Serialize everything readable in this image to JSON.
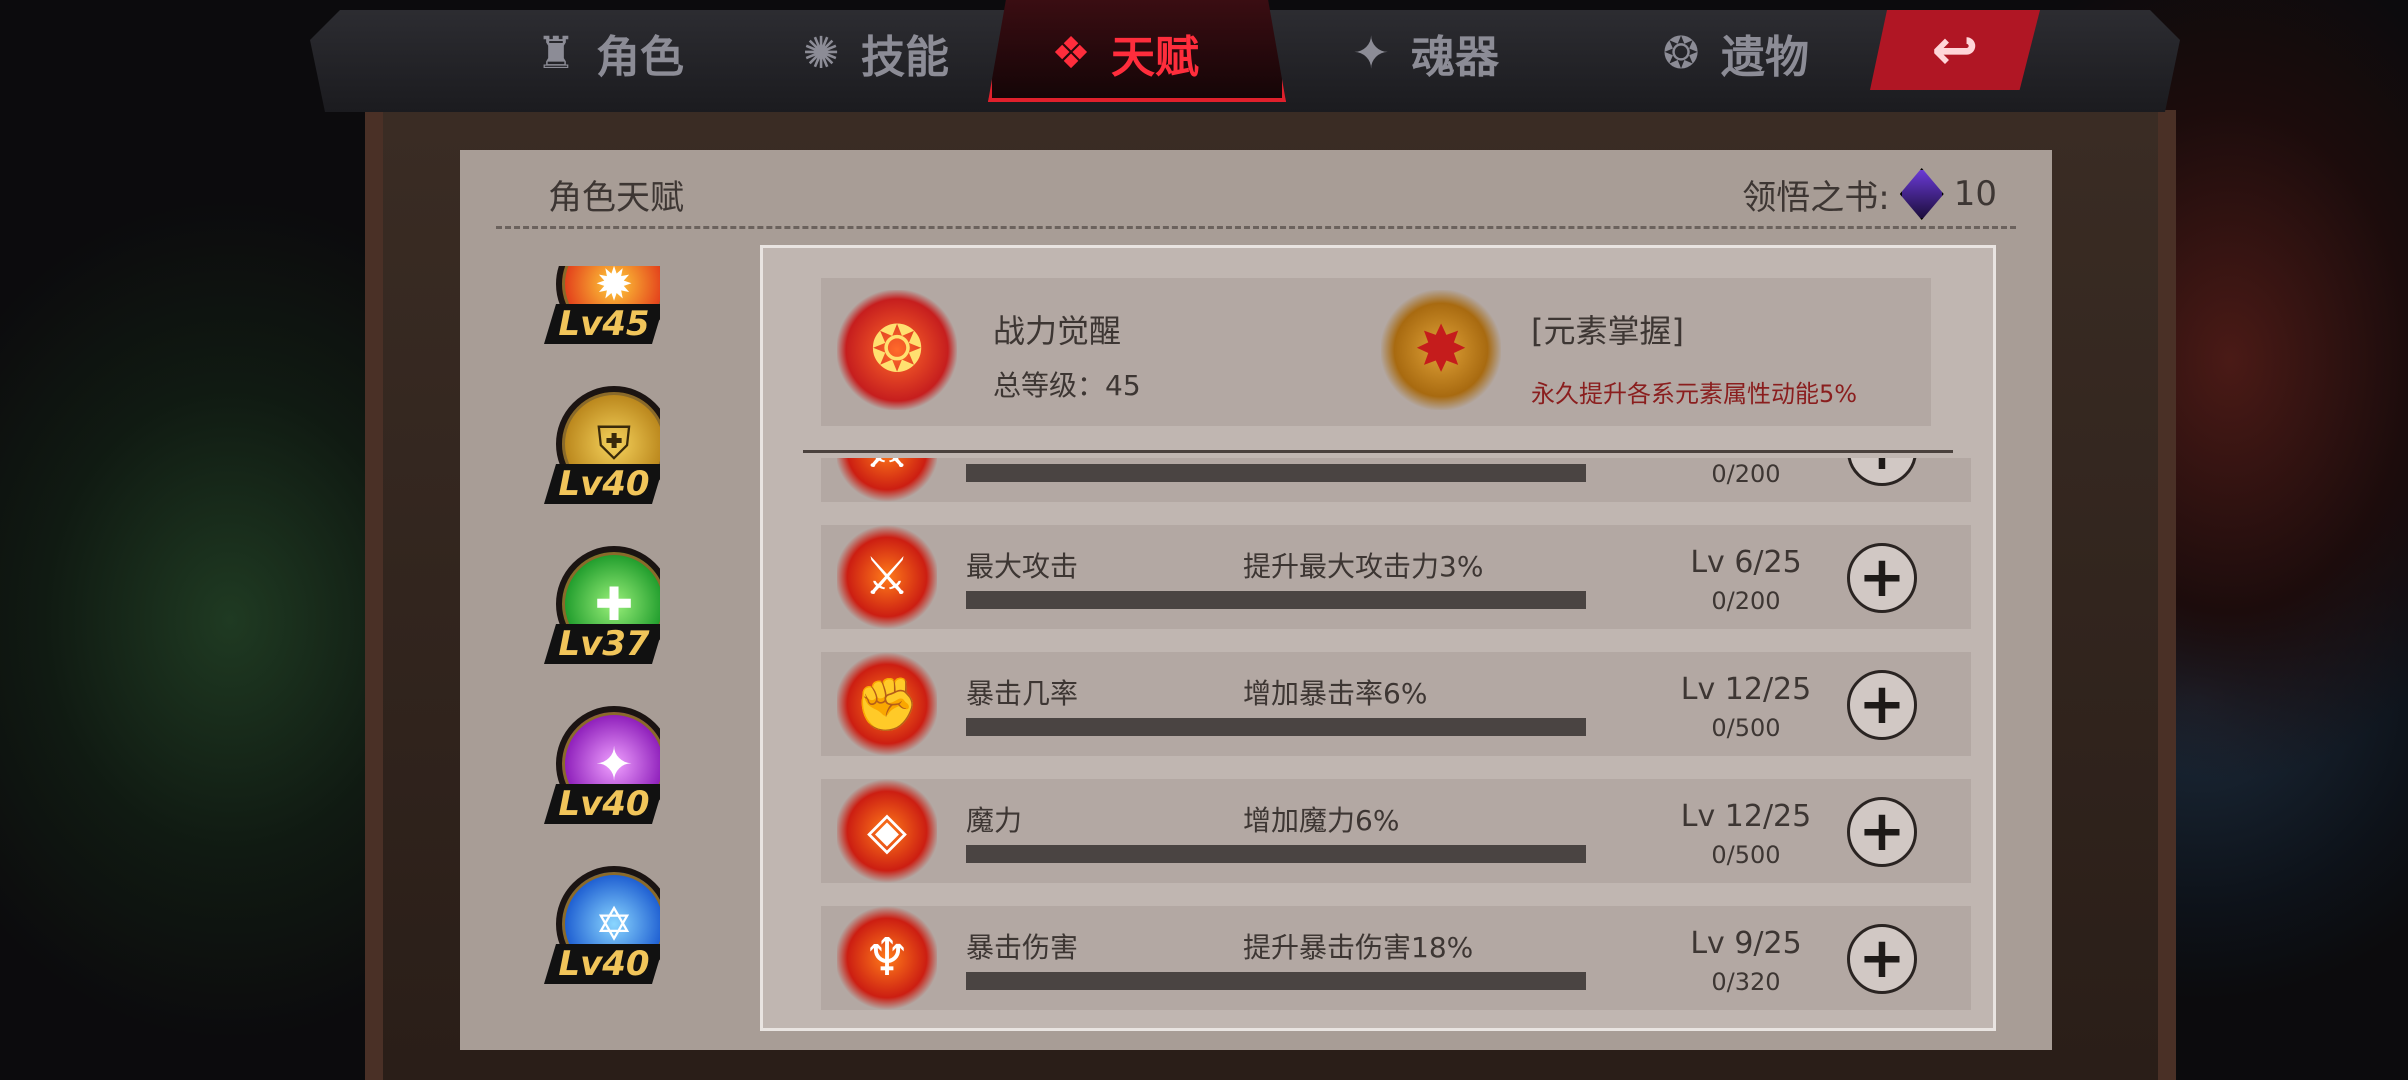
{
  "tabs": [
    {
      "label": "角色",
      "icon": "helmet-icon",
      "active": false
    },
    {
      "label": "技能",
      "icon": "skill-swirl-icon",
      "active": false
    },
    {
      "label": "天赋",
      "icon": "talent-diamond-icon",
      "active": true
    },
    {
      "label": "魂器",
      "icon": "soul-vessel-icon",
      "active": false
    },
    {
      "label": "遗物",
      "icon": "relic-icon",
      "active": false
    }
  ],
  "back_button": {
    "icon": "back-arrow-icon",
    "symbol": "↩"
  },
  "panel": {
    "title": "角色天赋",
    "book_label": "领悟之书:",
    "book_count": "10"
  },
  "roster": [
    {
      "level": "Lv45",
      "icon": "flame-emblem-icon",
      "color": "#e23a1a"
    },
    {
      "level": "Lv40",
      "icon": "shield-emblem-icon",
      "color": "#d8a426"
    },
    {
      "level": "Lv37",
      "icon": "heal-cross-emblem-icon",
      "color": "#2ec23a"
    },
    {
      "level": "Lv40",
      "icon": "arcane-star-emblem-icon",
      "color": "#b23ad8"
    },
    {
      "level": "Lv40",
      "icon": "hex-star-emblem-icon",
      "color": "#2a7ae0"
    }
  ],
  "awakening": {
    "name": "战力觉醒",
    "total_level": "总等级：45",
    "element_name": "[元素掌握]",
    "element_desc": "永久提升各系元素属性动能5%"
  },
  "talents": [
    {
      "name": "",
      "desc": "",
      "level": "",
      "progress_text": "0/200",
      "progress": 0,
      "icon": "sword-flame-icon"
    },
    {
      "name": "最大攻击",
      "desc": "提升最大攻击力3%",
      "level": "Lv 6/25",
      "progress_text": "0/200",
      "progress": 0,
      "icon": "sword-flame-icon"
    },
    {
      "name": "暴击几率",
      "desc": "增加暴击率6%",
      "level": "Lv 12/25",
      "progress_text": "0/500",
      "progress": 0,
      "icon": "fist-flame-icon"
    },
    {
      "name": "魔力",
      "desc": "增加魔力6%",
      "level": "Lv 12/25",
      "progress_text": "0/500",
      "progress": 0,
      "icon": "rune-flame-icon"
    },
    {
      "name": "暴击伤害",
      "desc": "提升暴击伤害18%",
      "level": "Lv 9/25",
      "progress_text": "0/320",
      "progress": 0,
      "icon": "demon-flame-icon"
    }
  ],
  "colors": {
    "accent": "#ff2d3c",
    "panel": "#a89d96",
    "description_red": "#8a1e1e"
  }
}
